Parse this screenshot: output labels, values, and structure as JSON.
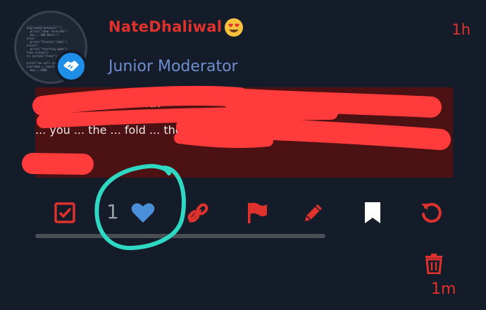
{
  "post": {
    "username": "NateDhaliwal",
    "user_title": "Junior Moderator",
    "time": "1h",
    "text_lines": [
      "I don't ... know ... with",
      "... you ... the ... fold ... the",
      "..."
    ],
    "accent_color": "#e0322c",
    "title_color": "#6f8ed0",
    "background": "#141b29",
    "post_background": "#4b1113"
  },
  "actions": {
    "like_count": "1",
    "icons": [
      "checkbox-icon",
      "heart-icon",
      "link-icon",
      "flag-icon",
      "pencil-icon",
      "bookmark-icon",
      "undo-icon"
    ]
  },
  "reply": {
    "time": "1m",
    "icon": "trash-icon"
  }
}
